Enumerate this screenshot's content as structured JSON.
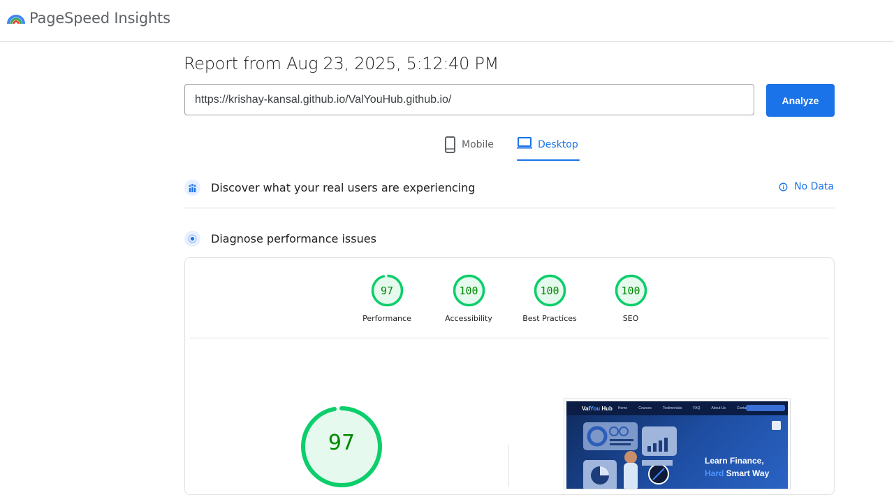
{
  "app": {
    "title": "PageSpeed Insights"
  },
  "report": {
    "title": "Report from Aug 23, 2025, 5:12:40 PM"
  },
  "search": {
    "url": "https://krishay-kansal.github.io/ValYouHub.github.io/",
    "analyze_label": "Analyze"
  },
  "tabs": [
    {
      "label": "Mobile",
      "icon": "smartphone-icon",
      "selected": false
    },
    {
      "label": "Desktop",
      "icon": "laptop-icon",
      "selected": true
    }
  ],
  "field_data": {
    "title": "Discover what your real users are experiencing",
    "status": "No Data"
  },
  "lab": {
    "title": "Diagnose performance issues"
  },
  "scores": [
    {
      "label": "Performance",
      "value": "97",
      "fraction": 0.97
    },
    {
      "label": "Accessibility",
      "value": "100",
      "fraction": 1.0
    },
    {
      "label": "Best Practices",
      "value": "100",
      "fraction": 1.0
    },
    {
      "label": "SEO",
      "value": "100",
      "fraction": 1.0
    }
  ],
  "performance_big": {
    "value": "97",
    "fraction": 0.97
  },
  "screenshot": {
    "brand_a": "Val",
    "brand_b": "You",
    "brand_c": " Hub",
    "nav": [
      "Home",
      "Courses",
      "Testimonials",
      "FAQ",
      "About Us",
      "Contact"
    ],
    "headline_line1": "Learn Finance,",
    "headline_strike": "Hard",
    "headline_rest": " Smart Way"
  },
  "colors": {
    "accent": "#1a73e8",
    "pass": "#0cce6b",
    "pass_text": "#008800",
    "pass_fill": "#e6f9ee"
  }
}
